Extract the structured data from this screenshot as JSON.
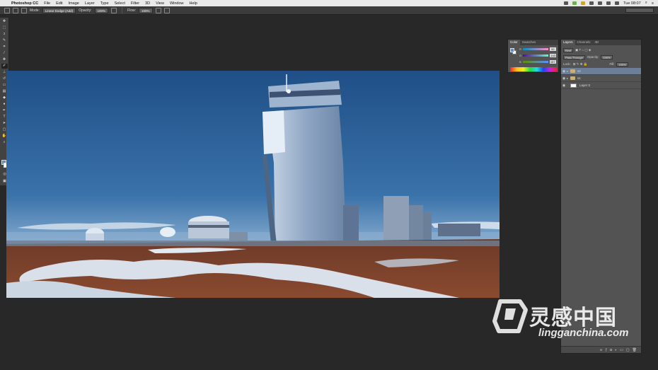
{
  "menubar": {
    "apple_icon": "apple-icon",
    "app_name": "Photoshop CC",
    "items": [
      "File",
      "Edit",
      "Image",
      "Layer",
      "Type",
      "Select",
      "Filter",
      "3D",
      "View",
      "Window",
      "Help"
    ],
    "clock": "Tue 08:07"
  },
  "options_bar": {
    "mode_label": "Mode:",
    "mode_value": "Linear Dodge (Add)",
    "opacity_label": "Opacity:",
    "opacity_value": "100%",
    "flow_label": "Flow:",
    "flow_value": "100%"
  },
  "tools": [
    "move-tool",
    "marquee-tool",
    "lasso-tool",
    "quick-select-tool",
    "crop-tool",
    "eyedropper-tool",
    "healing-tool",
    "brush-tool",
    "clone-stamp-tool",
    "history-brush-tool",
    "eraser-tool",
    "gradient-tool",
    "blur-tool",
    "dodge-tool",
    "pen-tool",
    "type-tool",
    "path-select-tool",
    "shape-tool",
    "hand-tool",
    "zoom-tool"
  ],
  "color_panel": {
    "tabs": [
      "Color",
      "Swatches"
    ],
    "channels": [
      {
        "label": "R",
        "value": "92"
      },
      {
        "label": "G",
        "value": "143"
      },
      {
        "label": "B",
        "value": "197"
      }
    ],
    "fg_color": "#5b8fc5"
  },
  "layers_panel": {
    "tabs": [
      "Layers",
      "Channels",
      "3D"
    ],
    "kind_label": "Kind",
    "blend_mode": "Pass Through",
    "opacity_label": "Opacity:",
    "opacity_value": "100%",
    "lock_label": "Lock:",
    "fill_label": "Fill:",
    "fill_value": "100%",
    "layers": [
      {
        "name": "s2",
        "type": "group",
        "selected": true
      },
      {
        "name": "s1",
        "type": "group",
        "selected": false
      },
      {
        "name": "Layer 0",
        "type": "pixel",
        "selected": false
      }
    ]
  },
  "watermark": {
    "cn_text": "灵感中国",
    "url_text": "lingganchina.com"
  }
}
